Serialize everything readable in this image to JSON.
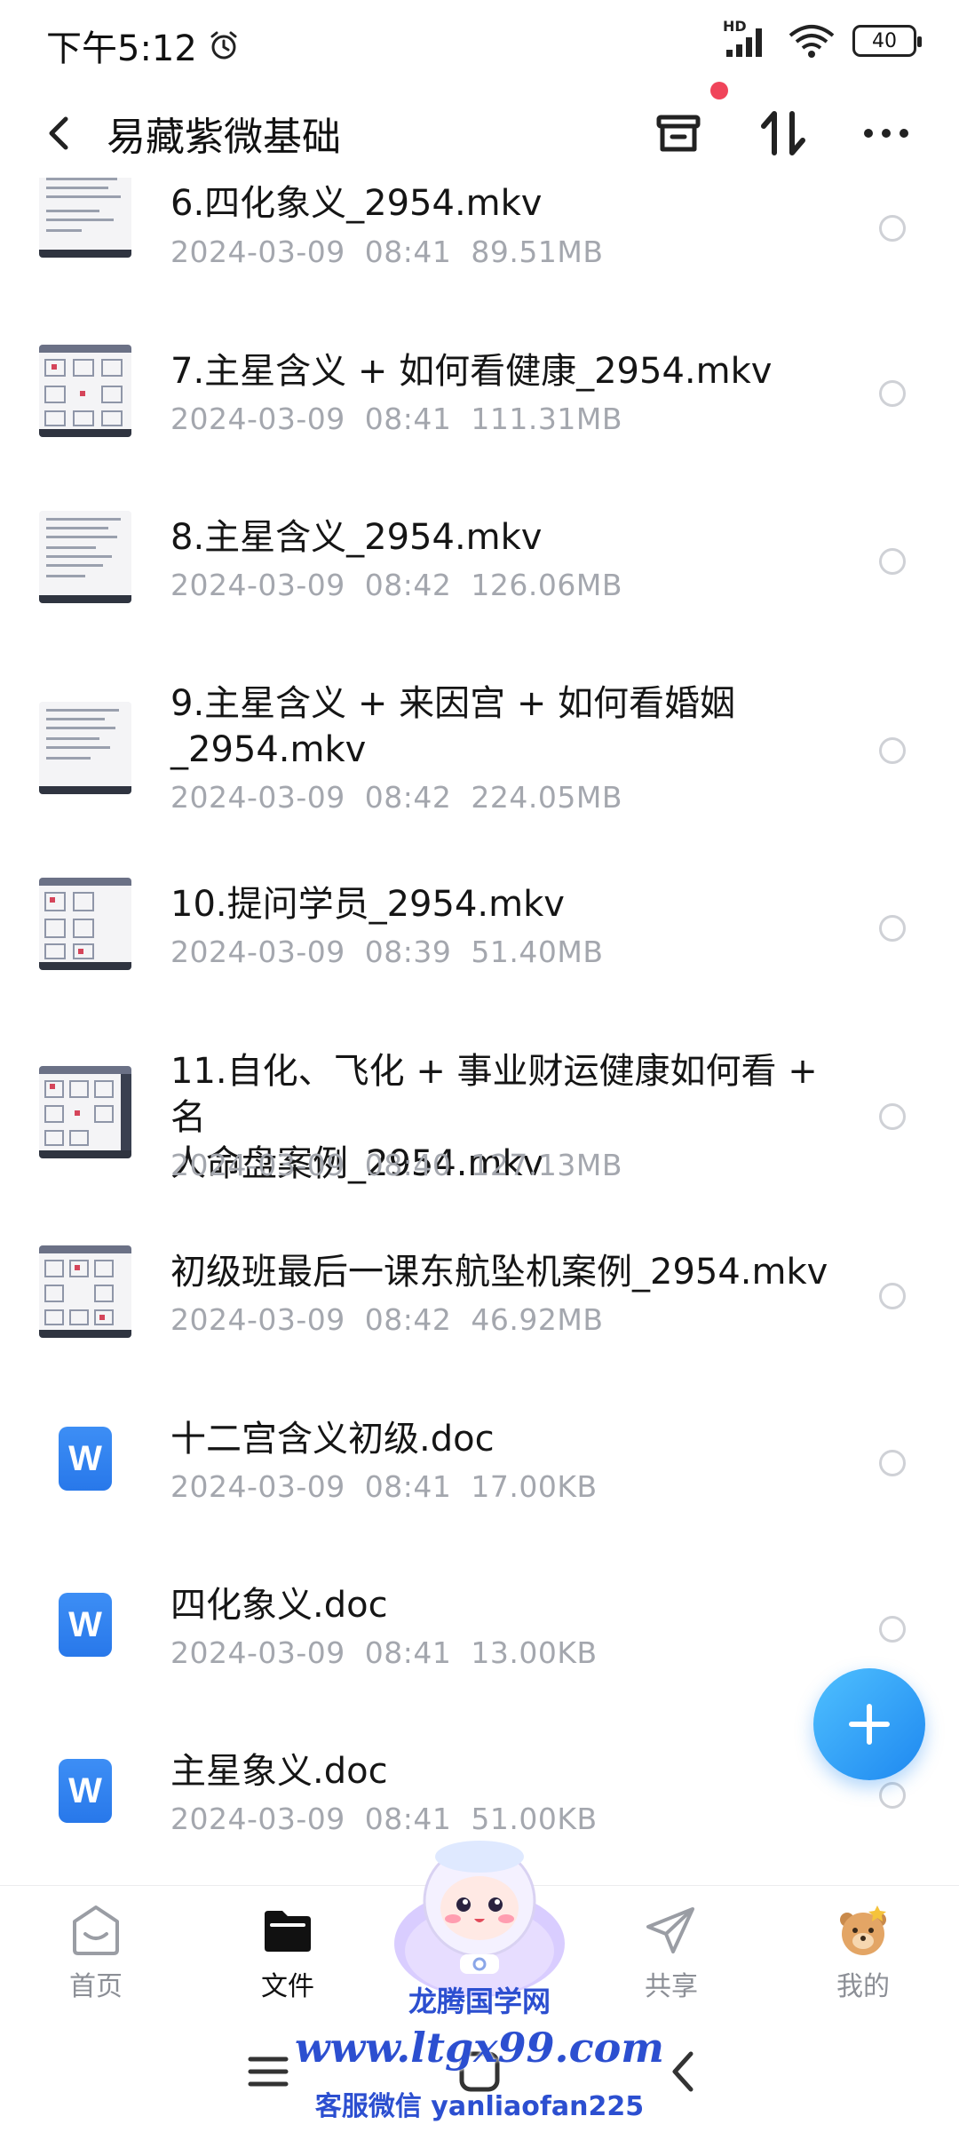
{
  "status_bar": {
    "time": "下午5:12",
    "network_label": "HD",
    "battery": "40",
    "icons": [
      "alarm-icon",
      "signal-icon",
      "wifi-icon",
      "battery-icon"
    ]
  },
  "header": {
    "title": "易藏紫微基础",
    "icons": [
      "back-icon",
      "recycle-bin-icon",
      "sort-icon",
      "more-icon"
    ],
    "badge_color": "#f0445a"
  },
  "files": [
    {
      "name": "6.四化象义_2954.mkv",
      "date": "2024-03-09",
      "time": "08:41",
      "size": "89.51MB",
      "type": "video"
    },
    {
      "name": "7.主星含义 + 如何看健康_2954.mkv",
      "date": "2024-03-09",
      "time": "08:41",
      "size": "111.31MB",
      "type": "video"
    },
    {
      "name": "8.主星含义_2954.mkv",
      "date": "2024-03-09",
      "time": "08:42",
      "size": "126.06MB",
      "type": "video"
    },
    {
      "name_line1": "9.主星含义 + 来因宫 + 如何看婚姻",
      "name_line2": "_2954.mkv",
      "date": "2024-03-09",
      "time": "08:42",
      "size": "224.05MB",
      "type": "video"
    },
    {
      "name": "10.提问学员_2954.mkv",
      "date": "2024-03-09",
      "time": "08:39",
      "size": "51.40MB",
      "type": "video"
    },
    {
      "name_line1": "11.自化、飞化 + 事业财运健康如何看 + 名",
      "name_line2": "人命盘案例_2954.mkv",
      "date": "2024-03-09",
      "time": "08:40",
      "size": "127.13MB",
      "type": "video"
    },
    {
      "name": "初级班最后一课东航坠机案例_2954.mkv",
      "date": "2024-03-09",
      "time": "08:42",
      "size": "46.92MB",
      "type": "video"
    },
    {
      "name": "十二宫含义初级.doc",
      "date": "2024-03-09",
      "time": "08:41",
      "size": "17.00KB",
      "type": "doc",
      "icon_letter": "W"
    },
    {
      "name": "四化象义.doc",
      "date": "2024-03-09",
      "time": "08:41",
      "size": "13.00KB",
      "type": "doc",
      "icon_letter": "W"
    },
    {
      "name": "主星象义.doc",
      "date": "2024-03-09",
      "time": "08:41",
      "size": "51.00KB",
      "type": "doc",
      "icon_letter": "W"
    }
  ],
  "fab": {
    "icon": "plus-icon",
    "color": "#1e88f0"
  },
  "bottom_nav": {
    "items": [
      {
        "label": "首页",
        "icon": "home-icon",
        "active": false
      },
      {
        "label": "文件",
        "icon": "folder-icon",
        "active": true
      },
      {
        "label": "共享",
        "icon": "share-icon",
        "active": false
      },
      {
        "label": "我的",
        "icon": "profile-icon",
        "active": false
      }
    ]
  },
  "watermark": {
    "line1": "龙腾国学网",
    "line2": "www.ltgx99.com",
    "line3": "客服微信 yanliaofan225"
  },
  "gesture_bar": {
    "icons": [
      "menu-icon",
      "home-square-icon",
      "back-arrow-icon"
    ]
  }
}
